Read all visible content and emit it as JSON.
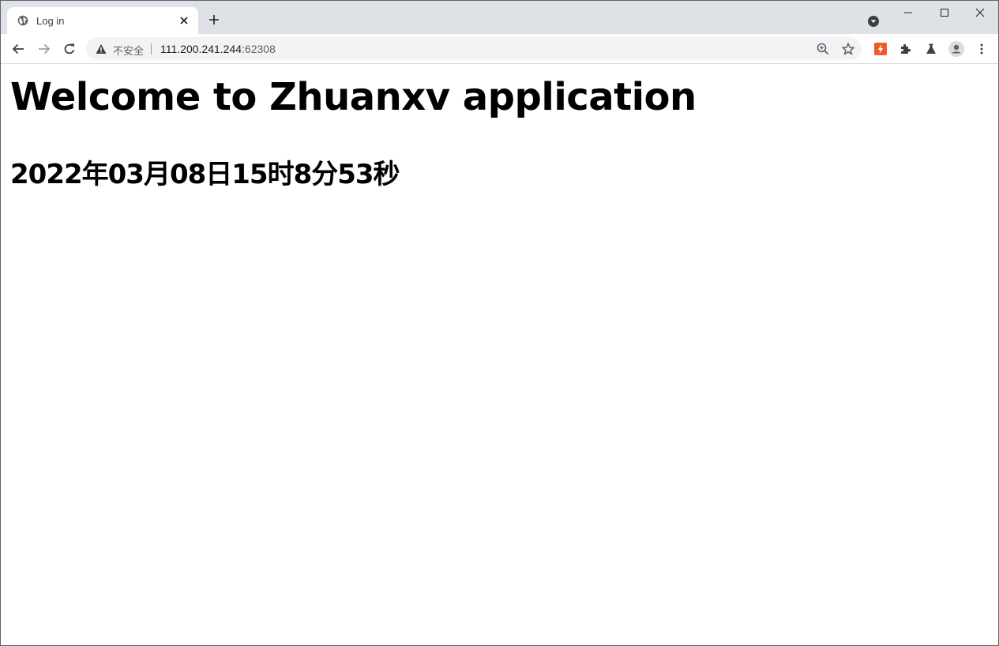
{
  "browser": {
    "tab": {
      "title": "Log in",
      "favicon": "globe-icon"
    },
    "omnibox": {
      "security_label": "不安全",
      "url_host": "111.200.241.244",
      "url_port": ":62308"
    },
    "colors": {
      "tabstrip": "#dee1e6",
      "omnibox": "#f1f3f4",
      "extension_accent": "#f05a28"
    }
  },
  "page": {
    "heading": "Welcome to Zhuanxv application",
    "datetime": "2022年03月08日15时8分53秒"
  }
}
